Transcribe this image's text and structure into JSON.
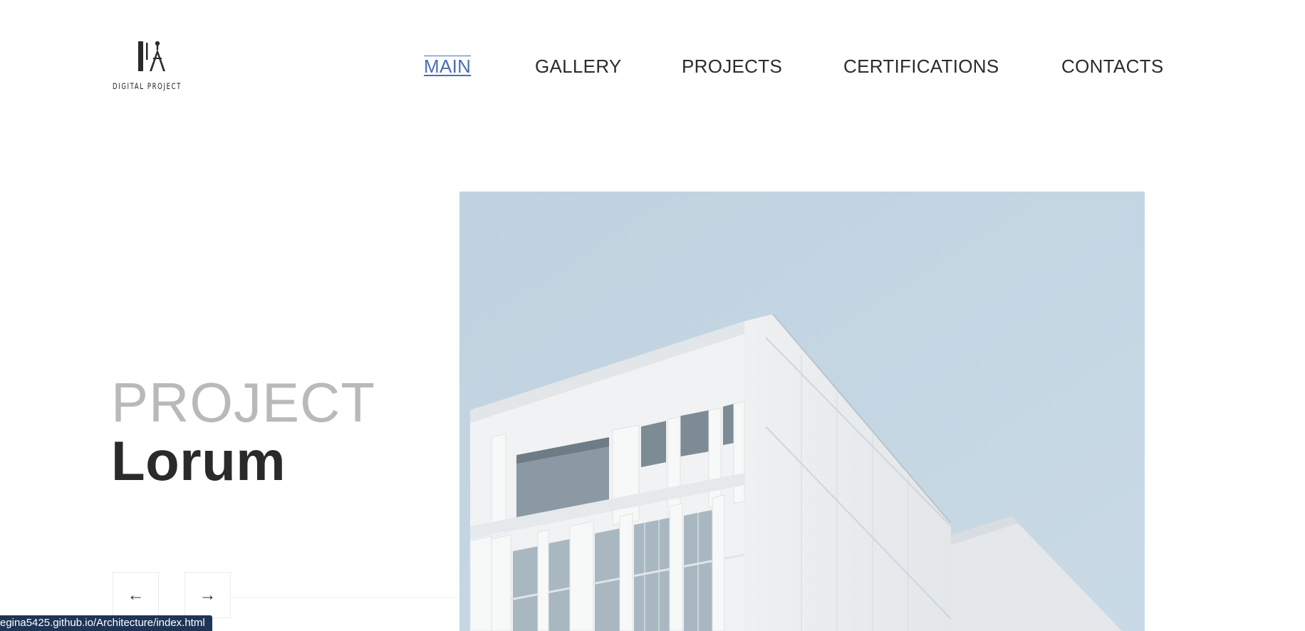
{
  "logo": {
    "text": "DIGITAL PROJECT",
    "icon": "drafting-compass-logo"
  },
  "nav": {
    "items": [
      {
        "label": "MAIN",
        "active": true
      },
      {
        "label": "GALLERY",
        "active": false
      },
      {
        "label": "PROJECTS",
        "active": false
      },
      {
        "label": "CERTIFICATIONS",
        "active": false
      },
      {
        "label": "CONTACTS",
        "active": false
      }
    ]
  },
  "hero": {
    "kicker": "PROJECT",
    "title": "Lorum",
    "prev_label": "←",
    "next_label": "→",
    "image": "white-building-against-sky"
  },
  "status_bar": {
    "url": "egina5425.github.io/Architecture/index.html"
  },
  "colors": {
    "accent": "#4a6db8",
    "sky": "#c1d4e1",
    "heading_dark": "#2a2a2a",
    "heading_light": "#b9b9b9",
    "status_bg": "#1d3557"
  }
}
